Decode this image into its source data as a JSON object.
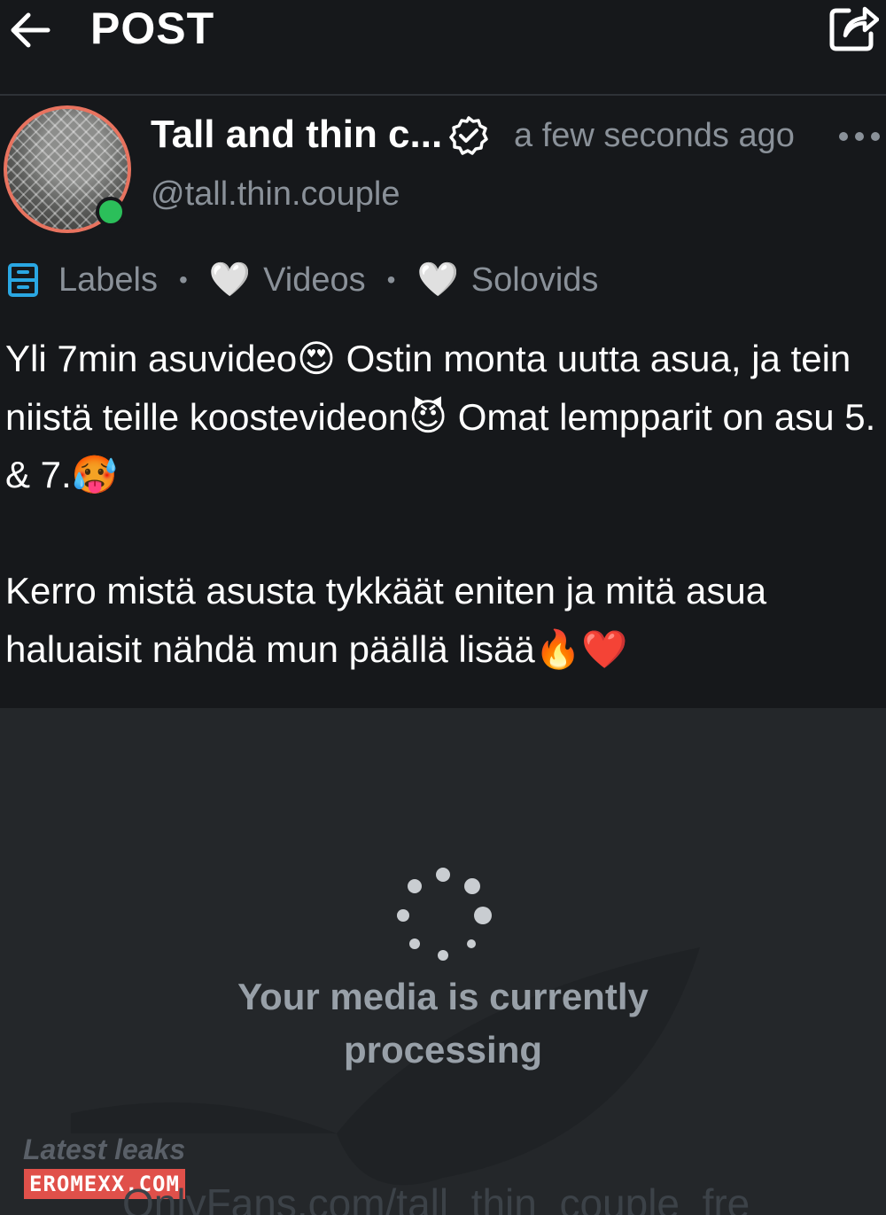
{
  "header": {
    "title": "POST",
    "back_icon": "arrow-left-icon",
    "share_icon": "share-icon"
  },
  "post": {
    "author": {
      "display_name": "Tall and thin c...",
      "handle": "@tall.thin.couple",
      "verified": true,
      "online": true
    },
    "timestamp": "a few seconds ago",
    "labels": {
      "title": "Labels",
      "items": [
        "Videos",
        "Solovids"
      ]
    },
    "text": {
      "line1": "Yli 7min asuvideo😍 Ostin monta uutta asua, ja tein niistä teille koostevideon😈 Omat lempparit on asu 5. & 7.🥵",
      "line2": "Kerro mistä asusta tykkäät eniten ja mitä asua haluaisit nähdä mun päällä lisää🔥❤️"
    }
  },
  "media": {
    "status_line1": "Your media is currently",
    "status_line2": "processing",
    "watermark_text": "Latest leaks",
    "watermark_site": "EROMEXX.COM",
    "watermark_url": "OnlyFans.com/tall_thin_couple_fre"
  },
  "colors": {
    "background": "#16181b",
    "media_background": "#24272a",
    "muted_text": "#8a9199",
    "avatar_ring": "#e8735f",
    "online": "#2bbf5a",
    "label_icon": "#2aa7e3"
  }
}
